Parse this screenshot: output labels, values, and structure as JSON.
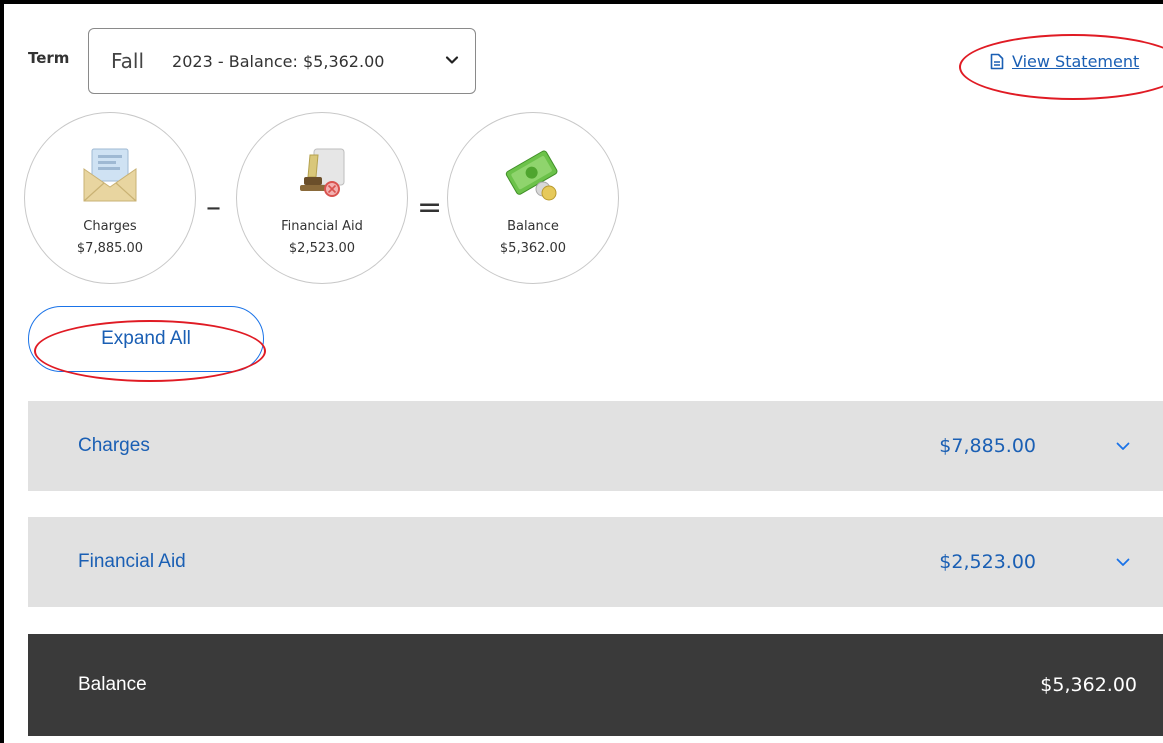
{
  "term": {
    "label": "Term",
    "season": "Fall",
    "rest": "2023 - Balance: $5,362.00"
  },
  "view_statement": {
    "label": "View Statement",
    "icon": "document-icon"
  },
  "summary": {
    "charges": {
      "title": "Charges",
      "value": "$7,885.00",
      "icon": "envelope-icon"
    },
    "minus": "–",
    "aid": {
      "title": "Financial Aid",
      "value": "$2,523.00",
      "icon": "certificate-icon"
    },
    "equals": "=",
    "balance": {
      "title": "Balance",
      "value": "$5,362.00",
      "icon": "money-icon"
    }
  },
  "expand_all": {
    "label": "Expand All"
  },
  "sections": {
    "charges": {
      "label": "Charges",
      "value": "$7,885.00"
    },
    "aid": {
      "label": "Financial Aid",
      "value": "$2,523.00"
    },
    "balance": {
      "label": "Balance",
      "value": "$5,362.00"
    }
  },
  "colors": {
    "link": "#1a5fb4",
    "highlight": "#e01b24",
    "section_bg": "#e1e1e1",
    "balance_bg": "#3a3a3a"
  }
}
